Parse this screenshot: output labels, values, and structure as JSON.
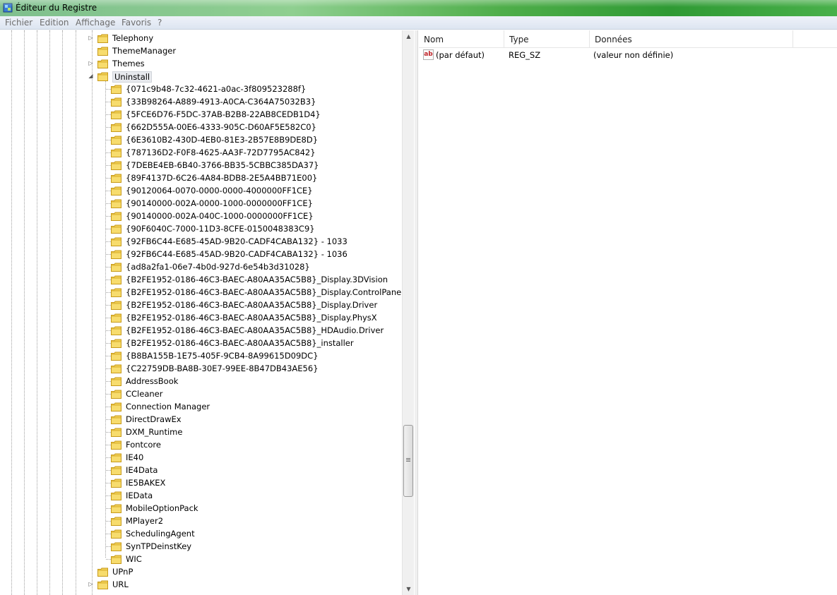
{
  "window": {
    "title": "Éditeur du Registre"
  },
  "menu": {
    "items": [
      "Fichier",
      "Edition",
      "Affichage",
      "Favoris",
      "?"
    ]
  },
  "tree": {
    "top_items": [
      {
        "label": "Telephony",
        "expander": "▷"
      },
      {
        "label": "ThemeManager",
        "expander": ""
      },
      {
        "label": "Themes",
        "expander": "▷"
      },
      {
        "label": "Uninstall",
        "expander": "◢"
      }
    ],
    "uninstall_children": [
      "{071c9b48-7c32-4621-a0ac-3f809523288f}",
      "{33B98264-A889-4913-A0CA-C364A75032B3}",
      "{5FCE6D76-F5DC-37AB-B2B8-22AB8CEDB1D4}",
      "{662D555A-00E6-4333-905C-D60AF5E582C0}",
      "{6E3610B2-430D-4EB0-81E3-2B57E8B9DE8D}",
      "{787136D2-F0F8-4625-AA3F-72D7795AC842}",
      "{7DEBE4EB-6B40-3766-BB35-5CBBC385DA37}",
      "{89F4137D-6C26-4A84-BDB8-2E5A4BB71E00}",
      "{90120064-0070-0000-0000-4000000FF1CE}",
      "{90140000-002A-0000-1000-0000000FF1CE}",
      "{90140000-002A-040C-1000-0000000FF1CE}",
      "{90F6040C-7000-11D3-8CFE-0150048383C9}",
      "{92FB6C44-E685-45AD-9B20-CADF4CABA132} - 1033",
      "{92FB6C44-E685-45AD-9B20-CADF4CABA132} - 1036",
      "{ad8a2fa1-06e7-4b0d-927d-6e54b3d31028}",
      "{B2FE1952-0186-46C3-BAEC-A80AA35AC5B8}_Display.3DVision",
      "{B2FE1952-0186-46C3-BAEC-A80AA35AC5B8}_Display.ControlPanel",
      "{B2FE1952-0186-46C3-BAEC-A80AA35AC5B8}_Display.Driver",
      "{B2FE1952-0186-46C3-BAEC-A80AA35AC5B8}_Display.PhysX",
      "{B2FE1952-0186-46C3-BAEC-A80AA35AC5B8}_HDAudio.Driver",
      "{B2FE1952-0186-46C3-BAEC-A80AA35AC5B8}_installer",
      "{B8BA155B-1E75-405F-9CB4-8A99615D09DC}",
      "{C22759DB-BA8B-30E7-99EE-8B47DB43AE56}",
      "AddressBook",
      "CCleaner",
      "Connection Manager",
      "DirectDrawEx",
      "DXM_Runtime",
      "Fontcore",
      "IE40",
      "IE4Data",
      "IE5BAKEX",
      "IEData",
      "MobileOptionPack",
      "MPlayer2",
      "SchedulingAgent",
      "SynTPDeinstKey",
      "WIC"
    ],
    "bottom_items": [
      {
        "label": "UPnP",
        "expander": ""
      },
      {
        "label": "URL",
        "expander": "▷"
      }
    ]
  },
  "list": {
    "columns": [
      "Nom",
      "Type",
      "Données"
    ],
    "rows": [
      {
        "name": "(par défaut)",
        "type": "REG_SZ",
        "data": "(valeur non définie)",
        "icon": "ab"
      }
    ]
  },
  "colors": {
    "folder": "#e8c23f",
    "title_gradient": "#4fae4a",
    "selected": "#e8eaee"
  }
}
